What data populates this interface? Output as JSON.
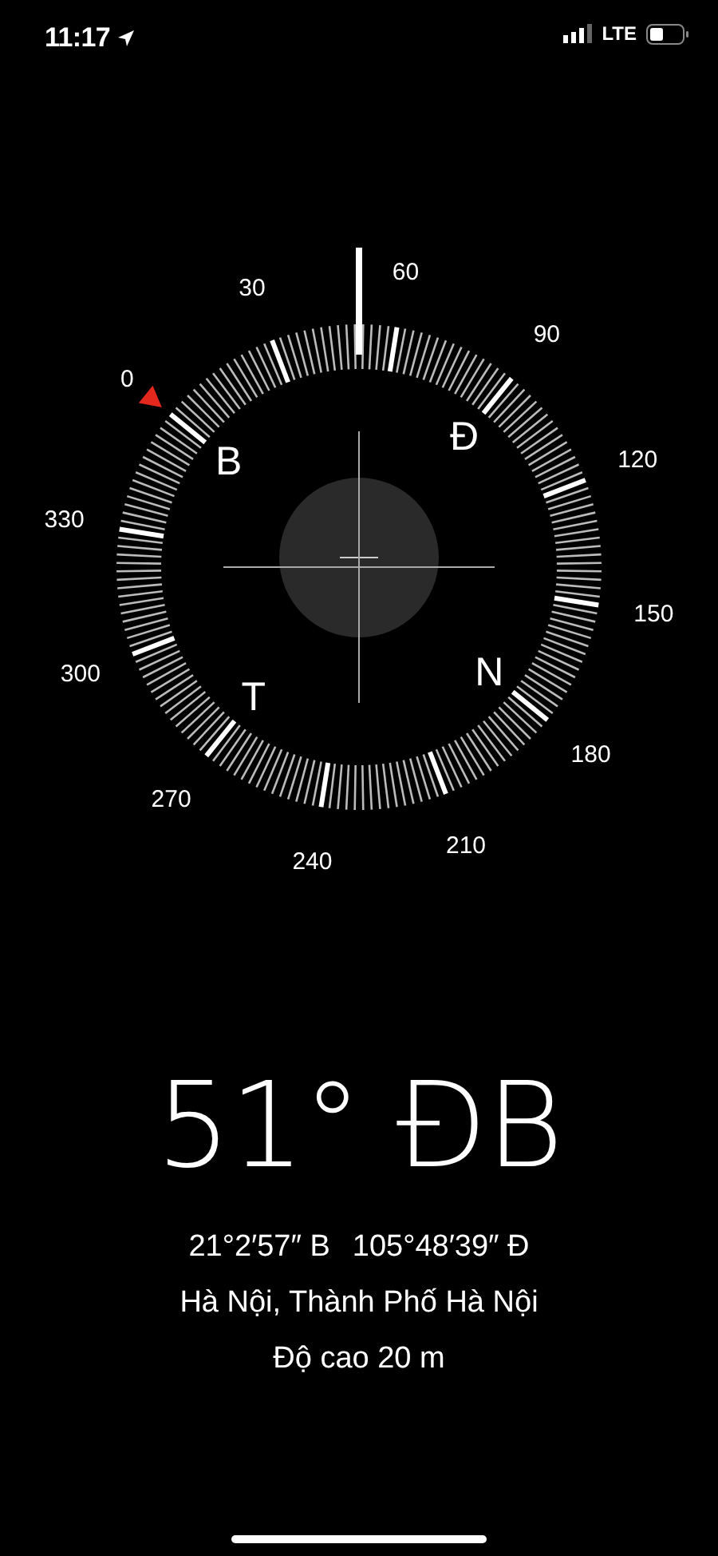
{
  "status_bar": {
    "time": "11:17",
    "network": "LTE"
  },
  "compass": {
    "degree_labels": [
      "0",
      "30",
      "60",
      "90",
      "120",
      "150",
      "180",
      "210",
      "240",
      "270",
      "300",
      "330"
    ],
    "direction_labels": [
      "B",
      "Đ",
      "N",
      "T"
    ]
  },
  "heading": "51° ĐB",
  "location": {
    "latitude": "21°2′57″ B",
    "longitude": "105°48′39″ Đ",
    "place": "Hà Nội, Thành Phố Hà Nội",
    "elevation": "Độ cao 20 m"
  }
}
